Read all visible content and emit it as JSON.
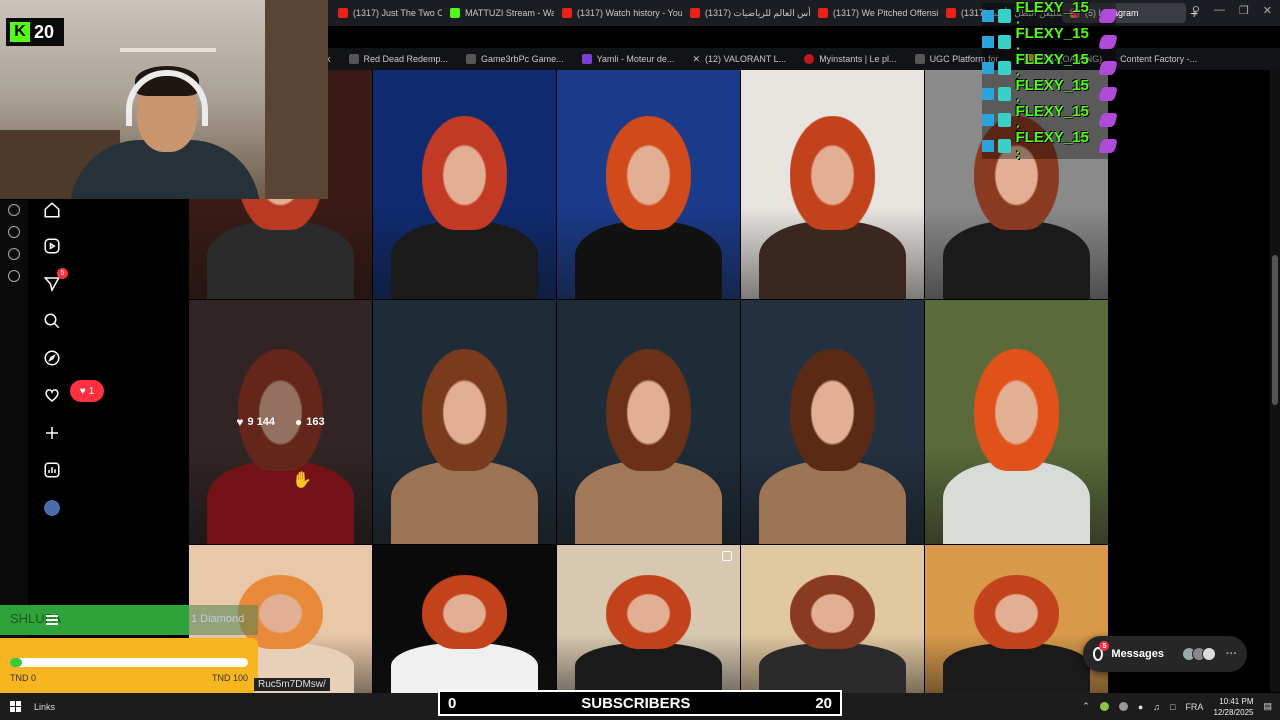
{
  "browser": {
    "tabs": [
      {
        "label": "(1317) Just The Two Of Us"
      },
      {
        "label": "MATTUZI Stream - Watch"
      },
      {
        "label": "(1317) Watch history - You"
      },
      {
        "label": "(1317) كأس العالم للرياضيات"
      },
      {
        "label": "(1317) We Pitched Offensi"
      },
      {
        "label": "(1317) سليفن البطل | أغنية |"
      }
    ],
    "active_tab": "(5) Instagram",
    "new_tab": "+"
  },
  "bookmarks": [
    {
      "label": "k"
    },
    {
      "label": "Red Dead Redemp..."
    },
    {
      "label": "Game3rbPc Game..."
    },
    {
      "label": "Yamli - Moteur de..."
    },
    {
      "label": "(12) VALORANT L..."
    },
    {
      "label": "Myinstants | Le pl..."
    },
    {
      "label": "UGC Platform for..."
    },
    {
      "label": "2K14(OAMING)"
    },
    {
      "label": "Content Factory -..."
    }
  ],
  "instagram": {
    "nav": {
      "notifications_badge": "5",
      "likes_pill": "1"
    },
    "hover_post": {
      "likes": "9 144",
      "comments": "163"
    },
    "tiles": [
      {
        "bg": "#3a1a14",
        "hair": "#b83a22",
        "body": "#2a2a2a"
      },
      {
        "bg": "#0f2a6e",
        "hair": "#c23a24",
        "body": "#1a1a1a"
      },
      {
        "bg": "#1a3a8a",
        "hair": "#d14a1c",
        "body": "#111111"
      },
      {
        "bg": "#e8e4e0",
        "hair": "#c2421c",
        "body": "#3a2820"
      },
      {
        "bg": "#8a8a8a",
        "hair": "#8a3a20",
        "body": "#1a1a1a"
      },
      {
        "bg": "#4a3a38",
        "hair": "#9a3a28",
        "body": "#b01c22"
      },
      {
        "bg": "#1e2c38",
        "hair": "#7a3a1c",
        "body": "#9a7454"
      },
      {
        "bg": "#1e2c38",
        "hair": "#6a3018",
        "body": "#a07a58"
      },
      {
        "bg": "#223040",
        "hair": "#5a2a14",
        "body": "#9a7454"
      },
      {
        "bg": "#5a6a3a",
        "hair": "#e0521a",
        "body": "#d8dcd8"
      },
      {
        "bg": "#e8c8a8",
        "hair": "#e88a3a",
        "body": "#e8d0b8"
      },
      {
        "bg": "#0a0a0a",
        "hair": "#c2421c",
        "body": "#f0f0f0"
      },
      {
        "bg": "#d8c8b0",
        "hair": "#c2421c",
        "body": "#1a1a1a"
      },
      {
        "bg": "#e0c8a0",
        "hair": "#8a3a20",
        "body": "#2a2a2a"
      },
      {
        "bg": "#d89a4a",
        "hair": "#c2421c",
        "body": "#1a1a1a"
      }
    ]
  },
  "webcam": {
    "kick_count": "20"
  },
  "chat_overlay": {
    "lines": [
      "FLEXY_15 :",
      "FLEXY_15 :",
      "FLEXY_15 :",
      "FLEXY_15 :",
      "FLEXY_15 :",
      "FLEXY_15 :"
    ]
  },
  "goal": {
    "name": "SHLUPA",
    "right_label": "1 Diamond",
    "tnd_min": "TND 0",
    "tnd_max": "TND 100",
    "progress": 0.05
  },
  "url_fragment": "Ruc5m7DMsw/",
  "messages": {
    "label": "Messages",
    "badge": "5",
    "more": "···"
  },
  "subscribers": {
    "label": "SUBSCRIBERS",
    "count": "20",
    "left": "0"
  },
  "taskbar": {
    "links": "Links",
    "lang": "FRA",
    "time": "10:41 PM",
    "date": "12/28/2025"
  }
}
